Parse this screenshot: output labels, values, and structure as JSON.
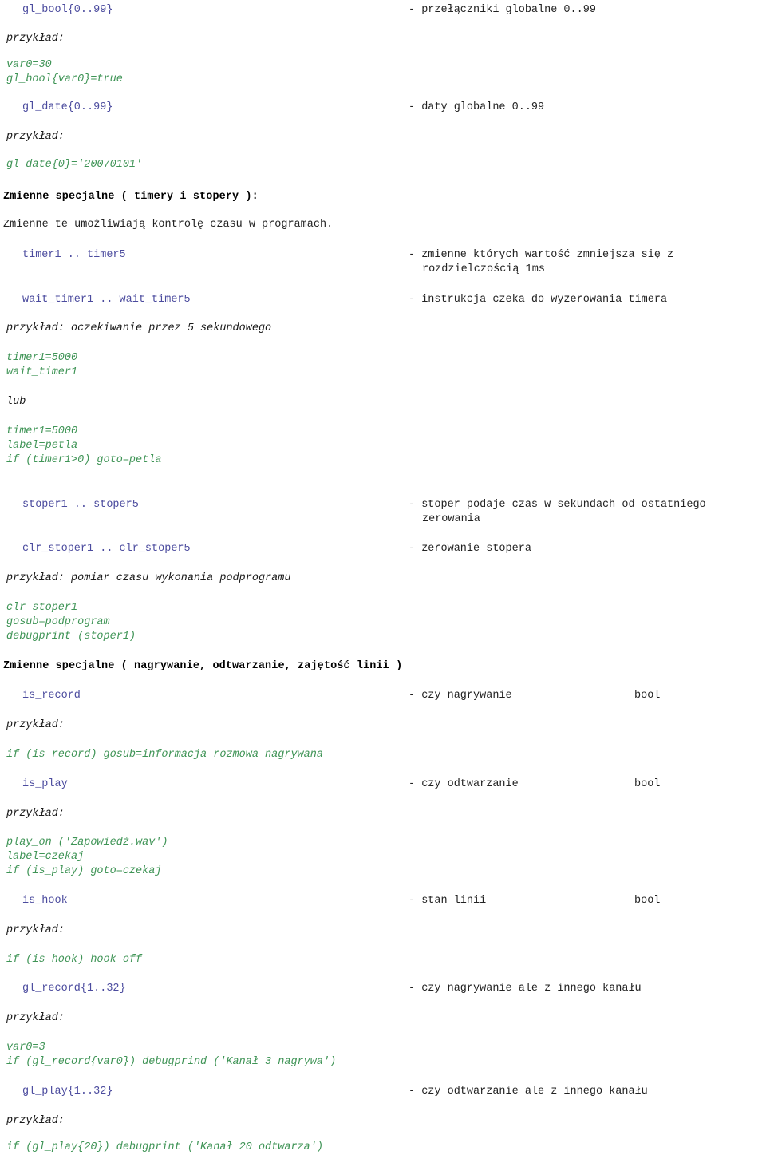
{
  "document": {
    "language": "pl",
    "kind": "programming-language-reference",
    "colors": {
      "identifier": "#4b4b9e",
      "code": "#3f9456",
      "text": "#222222",
      "heading": "#000000",
      "background": "#ffffff"
    }
  },
  "lines": {
    "gl_bool_name": "gl_bool{0..99}",
    "gl_bool_desc": "- przełączniki globalne 0..99",
    "przyklad_1": "przykład:",
    "code_1a": "var0=30",
    "code_1b": "gl_bool{var0}=true",
    "gl_date_name": "gl_date{0..99}",
    "gl_date_desc": "- daty globalne 0..99",
    "przyklad_2": "przykład:",
    "code_2a": "gl_date{0}='20070101'",
    "heading_1": "Zmienne specjalne ( timery i stopery ):",
    "para_1": "Zmienne te umożliwiają kontrolę czasu w programach.",
    "timer_name": "timer1 .. timer5",
    "timer_desc_1": "- zmienne których wartość zmniejsza się z",
    "timer_desc_2": "rozdzielczością 1ms",
    "wait_timer_name": "wait_timer1 .. wait_timer5",
    "wait_timer_desc": "- instrukcja czeka do wyzerowania timera",
    "przyklad_3": "przykład: oczekiwanie przez 5 sekundowego",
    "code_3a": "timer1=5000",
    "code_3b": "wait_timer1",
    "lub": "lub",
    "code_4a": "timer1=5000",
    "code_4b": "label=petla",
    "code_4c": "if (timer1>0) goto=petla",
    "stoper_name": "stoper1 .. stoper5",
    "stoper_desc_1": "- stoper podaje czas w sekundach od ostatniego",
    "stoper_desc_2": "zerowania",
    "clr_stoper_name": "clr_stoper1 .. clr_stoper5",
    "clr_stoper_desc": "- zerowanie stopera",
    "przyklad_4": "przykład: pomiar czasu wykonania podprogramu",
    "code_5a": "clr_stoper1",
    "code_5b": "gosub=podprogram",
    "code_5c": "debugprint (stoper1)",
    "heading_2": "Zmienne specjalne ( nagrywanie, odtwarzanie, zajętość linii )",
    "is_record_name": "is_record",
    "is_record_desc": "- czy nagrywanie",
    "is_record_type": "bool",
    "przyklad_5": "przykład:",
    "code_6a": "if (is_record) gosub=informacja_rozmowa_nagrywana",
    "is_play_name": "is_play",
    "is_play_desc": "- czy odtwarzanie",
    "is_play_type": "bool",
    "przyklad_6": "przykład:",
    "code_7a": "play_on ('Zapowiedź.wav')",
    "code_7b": "label=czekaj",
    "code_7c": "if (is_play) goto=czekaj",
    "is_hook_name": "is_hook",
    "is_hook_desc": "- stan linii",
    "is_hook_type": "bool",
    "przyklad_7": "przykład:",
    "code_8a": "if (is_hook) hook_off",
    "gl_record_name": "gl_record{1..32}",
    "gl_record_desc": "- czy nagrywanie ale z innego kanału",
    "przyklad_8": "przykład:",
    "code_9a": "var0=3",
    "code_9b": "if (gl_record{var0}) debugprind ('Kanał 3 nagrywa')",
    "gl_play_name": "gl_play{1..32}",
    "gl_play_desc": "- czy odtwarzanie ale z innego kanału",
    "przyklad_9": "przykład:",
    "code_10a": "if (gl_play{20}) debugprint ('Kanał 20 odtwarza')"
  }
}
